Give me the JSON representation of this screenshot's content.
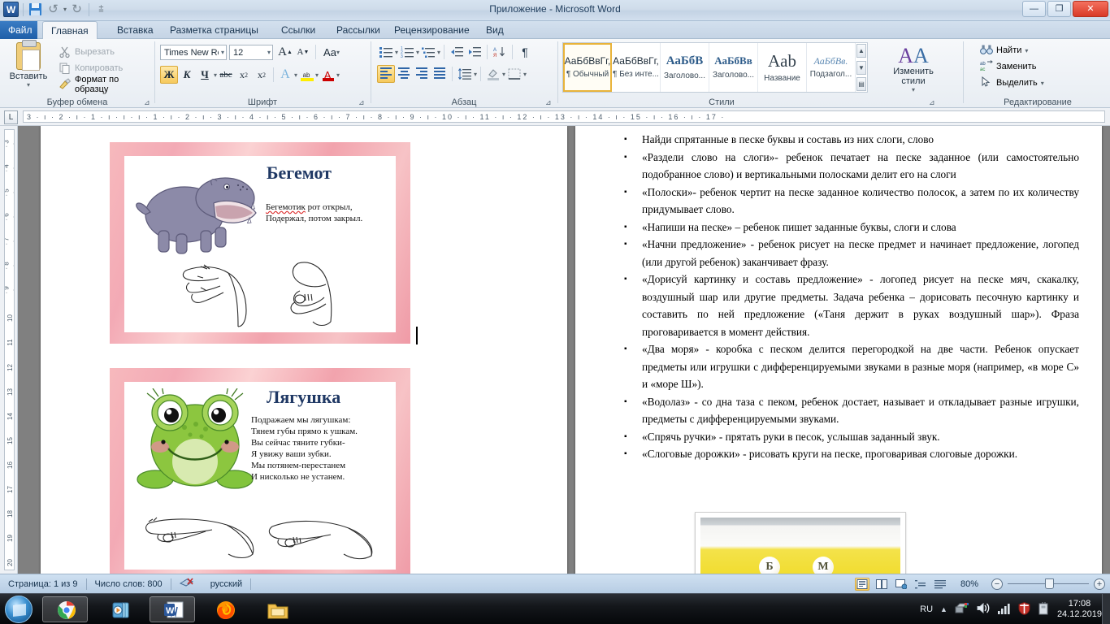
{
  "window": {
    "title": "Приложение  -  Microsoft Word",
    "minimize": "—",
    "maximize": "❐",
    "close": "✕",
    "quick_access": [
      "save-icon",
      "undo-icon",
      "redo-icon",
      "customize-qat-icon"
    ]
  },
  "tabs": [
    {
      "label": "Файл",
      "active": false,
      "file": true
    },
    {
      "label": "Главная",
      "active": true
    },
    {
      "label": "Вставка",
      "active": false
    },
    {
      "label": "Разметка страницы",
      "active": false
    },
    {
      "label": "Ссылки",
      "active": false
    },
    {
      "label": "Рассылки",
      "active": false
    },
    {
      "label": "Рецензирование",
      "active": false
    },
    {
      "label": "Вид",
      "active": false
    }
  ],
  "ribbon": {
    "clipboard": {
      "group_label": "Буфер обмена",
      "paste": "Вставить",
      "cut": "Вырезать",
      "copy": "Копировать",
      "format_painter": "Формат по образцу"
    },
    "font": {
      "group_label": "Шрифт",
      "font_name": "Times New Rc",
      "font_size": "12",
      "grow": "A",
      "shrink": "A",
      "change_case": "Aa",
      "bold": "Ж",
      "italic": "К",
      "underline": "Ч",
      "strikethrough": "abc",
      "subscript": "x₂",
      "superscript": "x²",
      "text_effects": "A",
      "highlight": "ab",
      "font_color": "A"
    },
    "paragraph": {
      "group_label": "Абзац",
      "bullets": "bullets-icon",
      "numbering": "numbering-icon",
      "multilevel": "multilevel-list-icon",
      "decrease_indent": "decrease-indent-icon",
      "increase_indent": "increase-indent-icon",
      "sort": "sort-icon",
      "show_marks": "¶",
      "align_left": "align-left-icon",
      "align_center": "align-center-icon",
      "align_right": "align-right-icon",
      "justify": "justify-icon",
      "line_spacing": "line-spacing-icon",
      "shading": "shading-icon",
      "borders": "borders-icon"
    },
    "styles": {
      "group_label": "Стили",
      "change_styles": "Изменить стили",
      "items": [
        {
          "preview": "АаБбВвГг,",
          "name": "¶ Обычный",
          "selected": true
        },
        {
          "preview": "АаБбВвГг,",
          "name": "¶ Без инте...",
          "selected": false
        },
        {
          "preview": "АаБбВ",
          "name": "Заголово...",
          "selected": false
        },
        {
          "preview": "АаБбВв",
          "name": "Заголово...",
          "selected": false
        },
        {
          "preview": "Aab",
          "name": "Название",
          "selected": false
        },
        {
          "preview": "АаБбВв.",
          "name": "Подзагол...",
          "selected": false
        }
      ]
    },
    "editing": {
      "group_label": "Редактирование",
      "find": "Найти",
      "replace": "Заменить",
      "select": "Выделить"
    }
  },
  "ruler": {
    "horizontal": "3 · ı · 2 · ı · 1 · ı · ı · ı · 1 · ı · 2 · ı · 3 · ı · 4 · ı · 5 · ı · 6 · ı · 7 · ı · 8 · ı · 9 · ı · 10 · ı · 11 · ı · 12 · ı · 13 · ı · 14 · ı · 15 · ı · 16 · ı · 17 ·",
    "vertical_marks": [
      "3",
      "4",
      "5",
      "6",
      "7",
      "8",
      "9",
      "10",
      "11",
      "12",
      "13",
      "14",
      "15",
      "16",
      "17",
      "18",
      "19",
      "20"
    ],
    "tab_selector": "L"
  },
  "document": {
    "cards": [
      {
        "title": "Бегемот",
        "poem": "Бегемотик рот открыл,\nПодержал, потом закрыл.",
        "first_word": "Бегемотик",
        "animal": "hippo-illustration",
        "hands": "hand-gesture-illustration"
      },
      {
        "title": "Лягушка",
        "poem": "Подражаем мы лягушкам:\nТянем губы прямо к ушкам.\nВы сейчас тяните губки-\nЯ увижу ваши зубки.\nМы потянем-перестанем\nИ нисколько не устанем.",
        "animal": "frog-illustration",
        "hands": "hand-gesture-illustration"
      }
    ],
    "bullets": [
      "  Найди спрятанные в песке буквы и составь из них слоги, слово",
      "«Раздели слово на слоги»- ребенок печатает на песке заданное (или самостоятельно подобранное слово) и вертикальными полосками делит его на слоги",
      "«Полоски»- ребенок чертит на песке заданное количество полосок, а затем по их количеству придумывает слово.",
      "«Напиши на песке» – ребенок пишет заданные буквы, слоги и слова",
      "«Начни предложение» - ребенок рисует на песке предмет и начинает предложение, логопед (или другой ребенок) заканчивает фразу.",
      "«Дорисуй картинку и составь предложение» - логопед рисует на песке мяч, скакалку, воздушный шар или другие предметы. Задача ребенка – дорисовать песочную картинку и составить по ней предложение («Таня держит в руках воздушный шар»). Фраза проговаривается в момент действия.",
      "«Два моря» - коробка с песком делится перегородкой на две части. Ребенок опускает предметы или игрушки с дифференцируемыми звуками в разные моря (например, «в море С» и «море Ш»).",
      "«Водолаз» - со дна таза с пеком, ребенок достает, называет и откладывает разные игрушки, предметы с дифференцируемыми звуками.",
      "«Спрячь ручки» - прятать руки в песок, услышав заданный звук.",
      "«Слоговые дорожки» - рисовать круги на песке, проговаривая слоговые дорожки."
    ],
    "photo_letters": [
      "Б",
      "М"
    ]
  },
  "status": {
    "page": "Страница: 1 из 9",
    "words": "Число слов: 800",
    "proofing": "proofing-errors-icon",
    "language": "русский",
    "zoom": "80%",
    "zoom_out": "−",
    "zoom_in": "+",
    "views": [
      "print-layout-icon",
      "full-screen-reading-icon",
      "web-layout-icon",
      "outline-icon",
      "draft-icon"
    ]
  },
  "taskbar": {
    "start": "start-orb-icon",
    "items": [
      "chrome-icon",
      "media-player-icon",
      "word-icon",
      "firefox-icon",
      "explorer-icon"
    ],
    "tray": {
      "language": "RU",
      "icons": [
        "show-hidden-icon",
        "network-icon",
        "volume-icon",
        "signal-icon",
        "security-icon",
        "device-icon"
      ],
      "time": "17:08",
      "date": "24.12.2019"
    }
  },
  "colors": {
    "accent": "#1f4f8f",
    "highlight": "#f6c95c",
    "title_blue": "#1f3864",
    "card_pink": "#f3aab5"
  }
}
